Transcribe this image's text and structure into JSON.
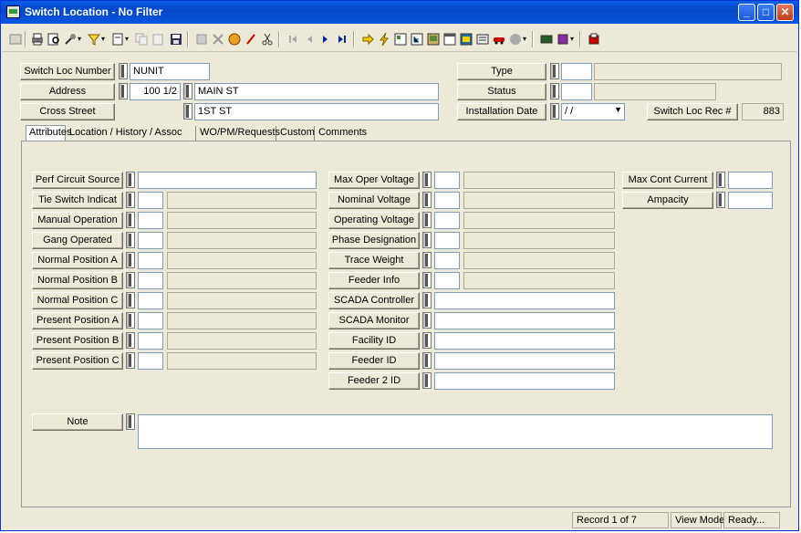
{
  "window": {
    "title": "Switch Location - No Filter"
  },
  "header": {
    "switch_loc_number": {
      "label": "Switch Loc Number",
      "value": "NUNIT"
    },
    "address": {
      "label": "Address",
      "number": "100 1/2",
      "street": "MAIN ST"
    },
    "cross_street": {
      "label": "Cross Street",
      "value": "1ST ST"
    },
    "type": {
      "label": "Type"
    },
    "status": {
      "label": "Status"
    },
    "installation_date": {
      "label": "Installation Date",
      "value": "/ /"
    },
    "switch_loc_rec": {
      "label": "Switch Loc Rec #",
      "value": "883"
    }
  },
  "tabs": [
    "Attributes",
    "Location / History / Assoc",
    "WO/PM/Requests",
    "Custom",
    "Comments"
  ],
  "attributes": {
    "col1": [
      "Perf Circuit Source",
      "Tie Switch Indicat",
      "Manual Operation",
      "Gang Operated",
      "Normal Position A",
      "Normal Position B",
      "Normal Position C",
      "Present Position A",
      "Present Position B",
      "Present Position C"
    ],
    "col2": [
      "Max Oper Voltage",
      "Nominal Voltage",
      "Operating Voltage",
      "Phase Designation",
      "Trace Weight",
      "Feeder Info",
      "SCADA Controller",
      "SCADA Monitor",
      "Facility ID",
      "Feeder ID",
      "Feeder 2 ID"
    ],
    "col3": [
      "Max Cont Current",
      "Ampacity"
    ],
    "note": "Note"
  },
  "statusbar": {
    "record": "Record 1 of 7",
    "mode": "View Mode",
    "state": "Ready..."
  },
  "toolbar_icons": [
    "window-icon",
    "print-icon",
    "preview-icon",
    "tools-icon",
    "filter-icon",
    "new-record-icon",
    "copy-icon",
    "paste-icon",
    "save-icon",
    "delete-icon",
    "spell-icon",
    "edit-icon",
    "cut-icon",
    "first-icon",
    "prev-icon",
    "next-icon",
    "last-icon",
    "goto-icon",
    "run-icon",
    "report-icon",
    "tree-icon",
    "map-icon",
    "calendar-icon",
    "chart-icon",
    "car-icon",
    "globe-icon",
    "list-icon",
    "book-icon",
    "exit-icon"
  ],
  "colors": {
    "titlebar": "#0546c9",
    "window_bg": "#ece9d8",
    "field_border": "#7f9db9"
  }
}
